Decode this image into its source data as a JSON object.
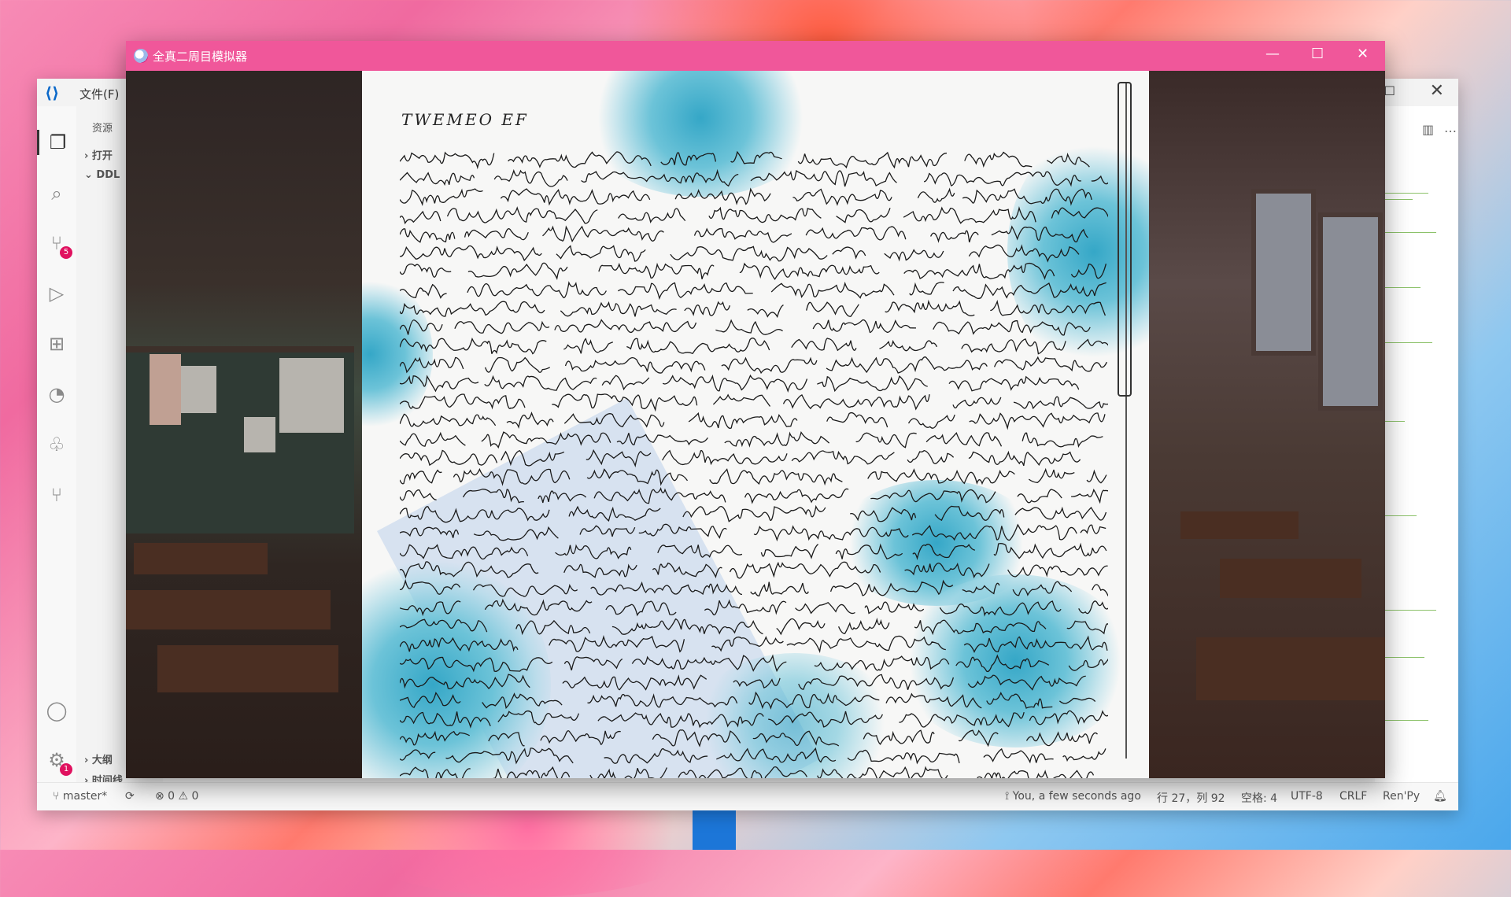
{
  "desktop": {},
  "vscode": {
    "menu_file": "文件(F)",
    "sidebar": {
      "explorer_title": "资源",
      "open_editors": "打开",
      "folder": "DDL",
      "outline": "大纲",
      "timeline": "时间线"
    },
    "activity_badges": {
      "source_control": "5",
      "settings": "1"
    },
    "status": {
      "branch": "master*",
      "problems": "⊗ 0 ⚠ 0",
      "blame": "You, a few seconds ago",
      "position": "行 27，列 92",
      "spaces": "空格: 4",
      "encoding": "UTF-8",
      "eol": "CRLF",
      "language": "Ren'Py"
    }
  },
  "game": {
    "title": "全真二周目模拟器",
    "buttons": {
      "minimize": "—",
      "maximize": "☐",
      "close": "✕"
    },
    "letter": {
      "title": "TWEMEO EF",
      "line_count": 36
    }
  },
  "colors": {
    "game_titlebar": "#f0579a",
    "ink": "#1a1a1a",
    "splash": "#35a7c7"
  }
}
